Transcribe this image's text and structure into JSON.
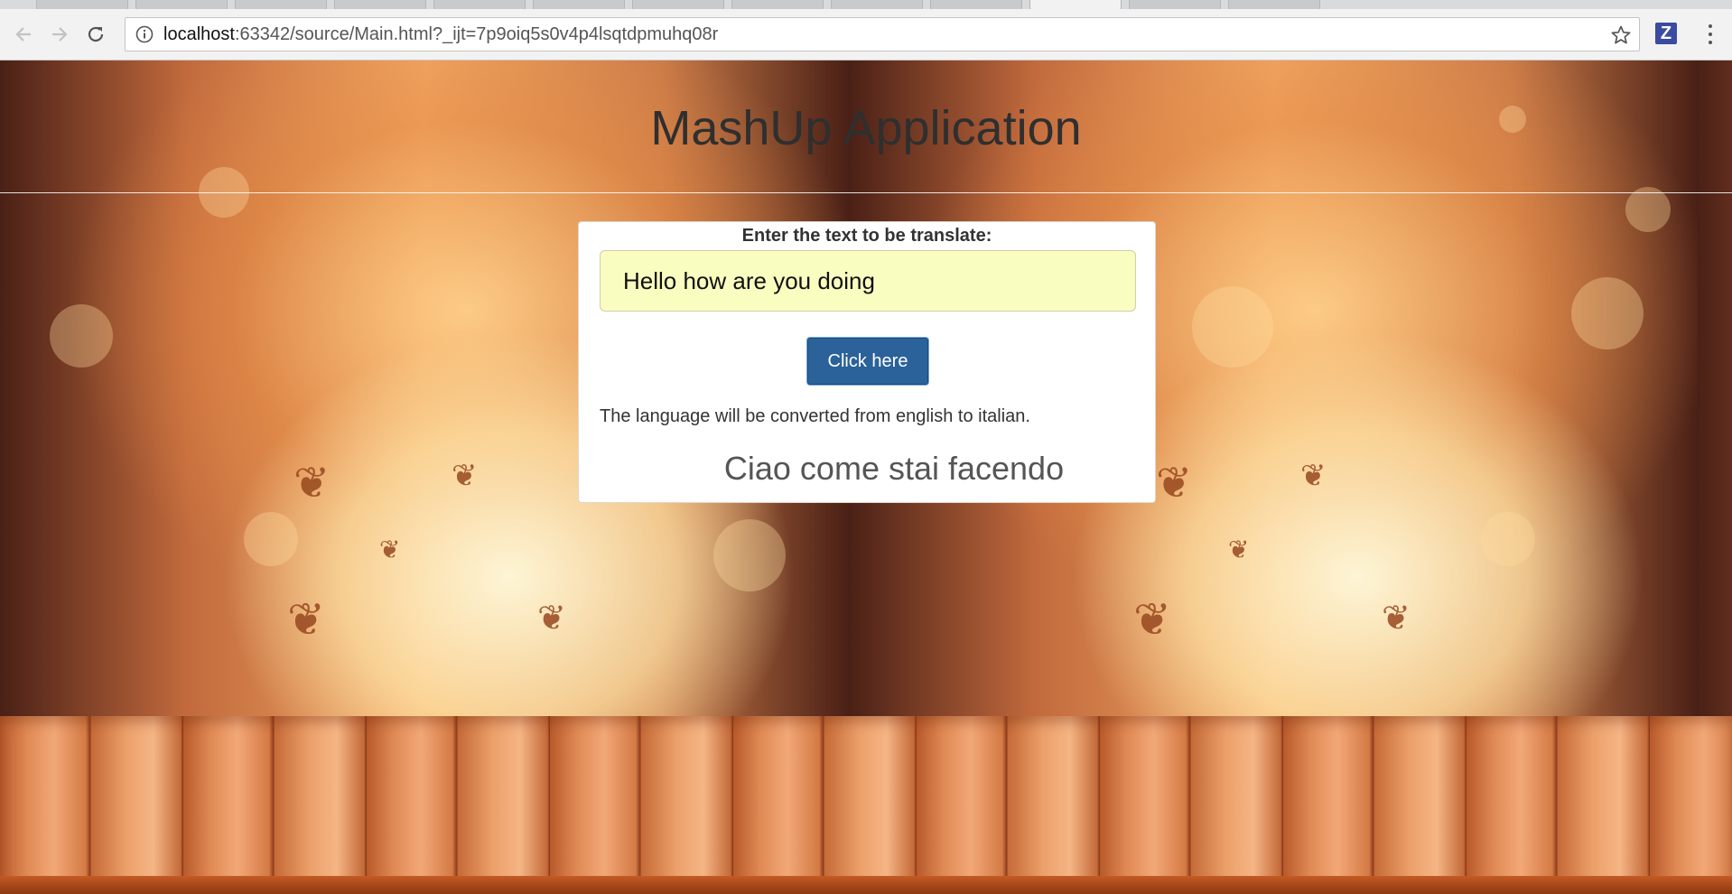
{
  "browser": {
    "url_host": "localhost",
    "url_rest": ":63342/source/Main.html?_ijt=7p9oiq5s0v4p4lsqtdpmuhq08r",
    "extension_label": "Z",
    "icons": [
      "back-icon",
      "forward-icon",
      "reload-icon",
      "info-icon",
      "star-icon",
      "menu-icon"
    ]
  },
  "page": {
    "title": "MashUp Application",
    "form": {
      "label": "Enter the text to be translate:",
      "input_value": "Hello how are you doing",
      "button_label": "Click here",
      "note": "The language will be converted from english to italian.",
      "result": "Ciao come stai facendo"
    },
    "colors": {
      "button": "#2a6299",
      "input_bg": "#fafdc0"
    }
  }
}
